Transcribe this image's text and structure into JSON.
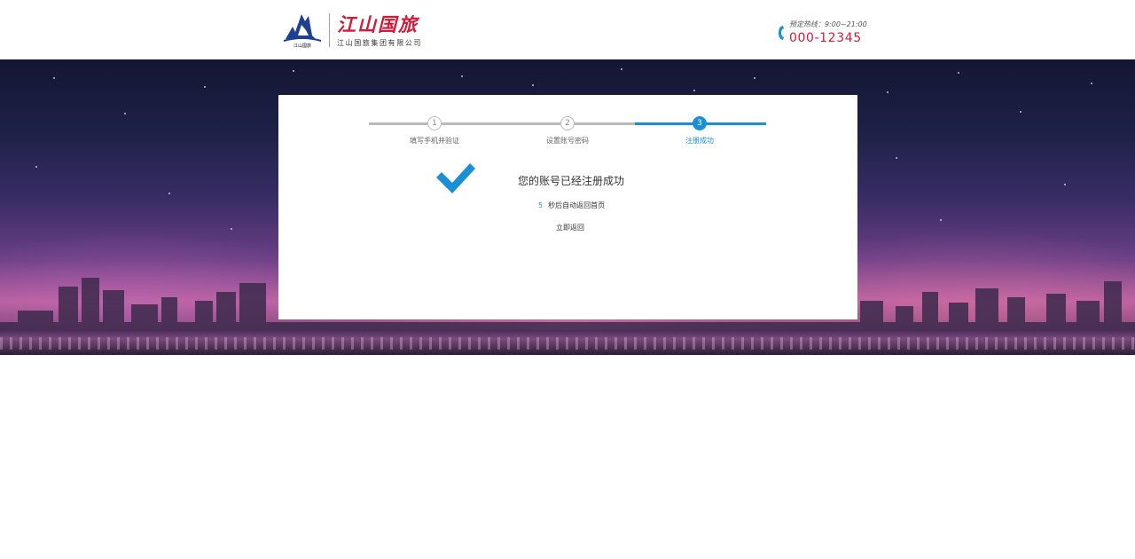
{
  "header": {
    "brand_name": "江山国旅",
    "brand_sub": "江山国旅集团有限公司",
    "logo_caption": "江山國旅",
    "hotline_label": "预定热线：9:00~21:00",
    "hotline_number": "000-12345"
  },
  "steps": [
    {
      "number": "1",
      "label": "填写手机并验证",
      "state": "done"
    },
    {
      "number": "2",
      "label": "设置账号密码",
      "state": "done"
    },
    {
      "number": "3",
      "label": "注册成功",
      "state": "active"
    }
  ],
  "result": {
    "message": "您的账号已经注册成功",
    "countdown_seconds": "5",
    "countdown_text": "秒后自动返回首页",
    "return_link": "立即返回"
  },
  "colors": {
    "brand_red": "#d21a3c",
    "accent_blue": "#1a8fd6",
    "step_gray": "#bbbbbb"
  },
  "icons": [
    "jiangshan-logo-icon",
    "phone-icon",
    "checkmark-icon"
  ]
}
